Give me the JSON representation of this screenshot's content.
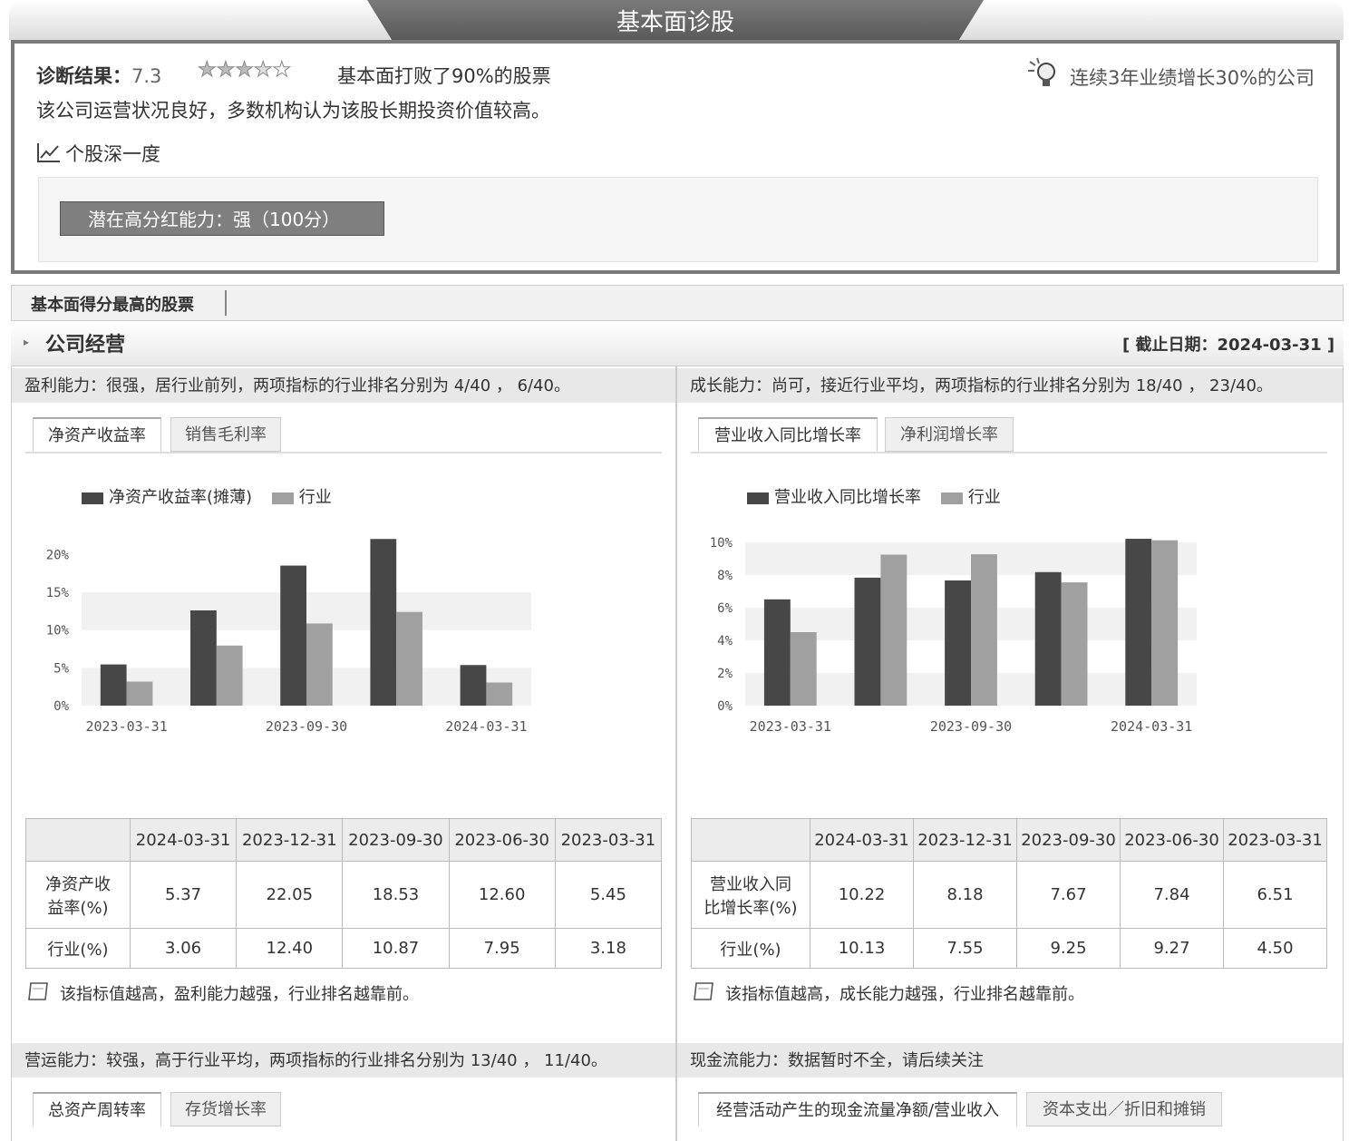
{
  "header": {
    "title": "基本面诊股"
  },
  "diagnosis": {
    "label": "诊断结果：",
    "score": "7.3",
    "stars": 3.5,
    "beat_text": "基本面打败了90%的股票",
    "summary": "该公司运营状况良好，多数机构认为该股长期投资价值较高。",
    "highlight": "连续3年业绩增长30%的公司",
    "deep_link": "个股深一度",
    "potential_button": "潜在高分红能力：强（100分）"
  },
  "best_stocks_tab": "基本面得分最高的股票",
  "company_section": {
    "title": "公司经营",
    "date_label": "[ 截止日期：2024-03-31 ]"
  },
  "profit": {
    "heading": "盈利能力：很强，居行业前列，两项指标的行业排名分别为 4/40 ，  6/40。",
    "tabs": [
      "净资产收益率",
      "销售毛利率"
    ],
    "legend": [
      "净资产收益率(摊薄)",
      "行业"
    ],
    "table": {
      "headers": [
        "2024-03-31",
        "2023-12-31",
        "2023-09-30",
        "2023-06-30",
        "2023-03-31"
      ],
      "rows": [
        {
          "label1": "净资产收",
          "label2": "益率(%)",
          "values": [
            "5.37",
            "22.05",
            "18.53",
            "12.60",
            "5.45"
          ]
        },
        {
          "label1": "行业(%)",
          "label2": "",
          "values": [
            "3.06",
            "12.40",
            "10.87",
            "7.95",
            "3.18"
          ]
        }
      ]
    },
    "note": "该指标值越高，盈利能力越强，行业排名越靠前。"
  },
  "growth": {
    "heading": "成长能力：尚可，接近行业平均，两项指标的行业排名分别为 18/40 ，  23/40。",
    "tabs": [
      "营业收入同比增长率",
      "净利润增长率"
    ],
    "legend": [
      "营业收入同比增长率",
      "行业"
    ],
    "table": {
      "headers": [
        "2024-03-31",
        "2023-12-31",
        "2023-09-30",
        "2023-06-30",
        "2023-03-31"
      ],
      "rows": [
        {
          "label1": "营业收入同",
          "label2": "比增长率(%)",
          "values": [
            "10.22",
            "8.18",
            "7.67",
            "7.84",
            "6.51"
          ]
        },
        {
          "label1": "行业(%)",
          "label2": "",
          "values": [
            "10.13",
            "7.55",
            "9.25",
            "9.27",
            "4.50"
          ]
        }
      ]
    },
    "note": "该指标值越高，成长能力越强，行业排名越靠前。"
  },
  "operation": {
    "heading": "营运能力：较强，高于行业平均，两项指标的行业排名分别为 13/40 ，  11/40。",
    "tabs": [
      "总资产周转率",
      "存货增长率"
    ]
  },
  "cashflow": {
    "heading": "现金流能力：数据暂时不全，请后续关注",
    "tabs": [
      "经营活动产生的现金流量净额/营业收入",
      "资本支出／折旧和摊销"
    ]
  },
  "chart_data": [
    {
      "type": "bar",
      "categories": [
        "2023-03-31",
        "2023-06-30",
        "2023-09-30",
        "2023-12-31",
        "2024-03-31"
      ],
      "x_tick_labels": [
        "2023-03-31",
        "2023-09-30",
        "2024-03-31"
      ],
      "series": [
        {
          "name": "净资产收益率(摊薄)",
          "values": [
            5.45,
            12.6,
            18.53,
            22.05,
            5.37
          ],
          "color": "#474747"
        },
        {
          "name": "行业",
          "values": [
            3.18,
            7.95,
            10.87,
            12.4,
            3.06
          ],
          "color": "#a0a0a0"
        }
      ],
      "yticks": [
        "0%",
        "5%",
        "10%",
        "15%",
        "20%"
      ],
      "ylim": [
        0,
        24
      ]
    },
    {
      "type": "bar",
      "categories": [
        "2023-03-31",
        "2023-06-30",
        "2023-09-30",
        "2023-12-31",
        "2024-03-31"
      ],
      "x_tick_labels": [
        "2023-03-31",
        "2023-09-30",
        "2024-03-31"
      ],
      "series": [
        {
          "name": "营业收入同比增长率",
          "values": [
            6.51,
            7.84,
            7.67,
            8.18,
            10.22
          ],
          "color": "#474747"
        },
        {
          "name": "行业",
          "values": [
            4.5,
            9.25,
            9.27,
            7.55,
            10.13
          ],
          "color": "#a0a0a0"
        }
      ],
      "yticks": [
        "0%",
        "2%",
        "4%",
        "6%",
        "8%",
        "10%"
      ],
      "ylim": [
        0,
        10
      ]
    }
  ]
}
